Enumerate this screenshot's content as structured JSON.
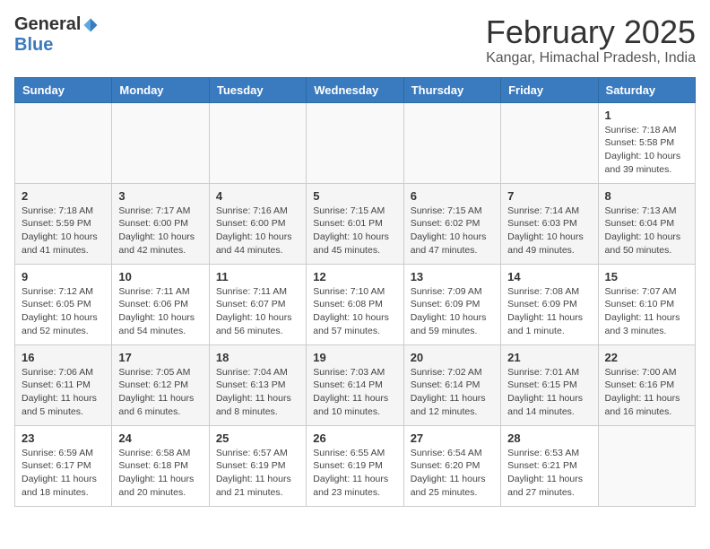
{
  "header": {
    "logo": {
      "general": "General",
      "blue": "Blue"
    },
    "month": "February 2025",
    "location": "Kangar, Himachal Pradesh, India"
  },
  "weekdays": [
    "Sunday",
    "Monday",
    "Tuesday",
    "Wednesday",
    "Thursday",
    "Friday",
    "Saturday"
  ],
  "weeks": [
    [
      {
        "day": "",
        "info": ""
      },
      {
        "day": "",
        "info": ""
      },
      {
        "day": "",
        "info": ""
      },
      {
        "day": "",
        "info": ""
      },
      {
        "day": "",
        "info": ""
      },
      {
        "day": "",
        "info": ""
      },
      {
        "day": "1",
        "info": "Sunrise: 7:18 AM\nSunset: 5:58 PM\nDaylight: 10 hours and 39 minutes."
      }
    ],
    [
      {
        "day": "2",
        "info": "Sunrise: 7:18 AM\nSunset: 5:59 PM\nDaylight: 10 hours and 41 minutes."
      },
      {
        "day": "3",
        "info": "Sunrise: 7:17 AM\nSunset: 6:00 PM\nDaylight: 10 hours and 42 minutes."
      },
      {
        "day": "4",
        "info": "Sunrise: 7:16 AM\nSunset: 6:00 PM\nDaylight: 10 hours and 44 minutes."
      },
      {
        "day": "5",
        "info": "Sunrise: 7:15 AM\nSunset: 6:01 PM\nDaylight: 10 hours and 45 minutes."
      },
      {
        "day": "6",
        "info": "Sunrise: 7:15 AM\nSunset: 6:02 PM\nDaylight: 10 hours and 47 minutes."
      },
      {
        "day": "7",
        "info": "Sunrise: 7:14 AM\nSunset: 6:03 PM\nDaylight: 10 hours and 49 minutes."
      },
      {
        "day": "8",
        "info": "Sunrise: 7:13 AM\nSunset: 6:04 PM\nDaylight: 10 hours and 50 minutes."
      }
    ],
    [
      {
        "day": "9",
        "info": "Sunrise: 7:12 AM\nSunset: 6:05 PM\nDaylight: 10 hours and 52 minutes."
      },
      {
        "day": "10",
        "info": "Sunrise: 7:11 AM\nSunset: 6:06 PM\nDaylight: 10 hours and 54 minutes."
      },
      {
        "day": "11",
        "info": "Sunrise: 7:11 AM\nSunset: 6:07 PM\nDaylight: 10 hours and 56 minutes."
      },
      {
        "day": "12",
        "info": "Sunrise: 7:10 AM\nSunset: 6:08 PM\nDaylight: 10 hours and 57 minutes."
      },
      {
        "day": "13",
        "info": "Sunrise: 7:09 AM\nSunset: 6:09 PM\nDaylight: 10 hours and 59 minutes."
      },
      {
        "day": "14",
        "info": "Sunrise: 7:08 AM\nSunset: 6:09 PM\nDaylight: 11 hours and 1 minute."
      },
      {
        "day": "15",
        "info": "Sunrise: 7:07 AM\nSunset: 6:10 PM\nDaylight: 11 hours and 3 minutes."
      }
    ],
    [
      {
        "day": "16",
        "info": "Sunrise: 7:06 AM\nSunset: 6:11 PM\nDaylight: 11 hours and 5 minutes."
      },
      {
        "day": "17",
        "info": "Sunrise: 7:05 AM\nSunset: 6:12 PM\nDaylight: 11 hours and 6 minutes."
      },
      {
        "day": "18",
        "info": "Sunrise: 7:04 AM\nSunset: 6:13 PM\nDaylight: 11 hours and 8 minutes."
      },
      {
        "day": "19",
        "info": "Sunrise: 7:03 AM\nSunset: 6:14 PM\nDaylight: 11 hours and 10 minutes."
      },
      {
        "day": "20",
        "info": "Sunrise: 7:02 AM\nSunset: 6:14 PM\nDaylight: 11 hours and 12 minutes."
      },
      {
        "day": "21",
        "info": "Sunrise: 7:01 AM\nSunset: 6:15 PM\nDaylight: 11 hours and 14 minutes."
      },
      {
        "day": "22",
        "info": "Sunrise: 7:00 AM\nSunset: 6:16 PM\nDaylight: 11 hours and 16 minutes."
      }
    ],
    [
      {
        "day": "23",
        "info": "Sunrise: 6:59 AM\nSunset: 6:17 PM\nDaylight: 11 hours and 18 minutes."
      },
      {
        "day": "24",
        "info": "Sunrise: 6:58 AM\nSunset: 6:18 PM\nDaylight: 11 hours and 20 minutes."
      },
      {
        "day": "25",
        "info": "Sunrise: 6:57 AM\nSunset: 6:19 PM\nDaylight: 11 hours and 21 minutes."
      },
      {
        "day": "26",
        "info": "Sunrise: 6:55 AM\nSunset: 6:19 PM\nDaylight: 11 hours and 23 minutes."
      },
      {
        "day": "27",
        "info": "Sunrise: 6:54 AM\nSunset: 6:20 PM\nDaylight: 11 hours and 25 minutes."
      },
      {
        "day": "28",
        "info": "Sunrise: 6:53 AM\nSunset: 6:21 PM\nDaylight: 11 hours and 27 minutes."
      },
      {
        "day": "",
        "info": ""
      }
    ]
  ]
}
